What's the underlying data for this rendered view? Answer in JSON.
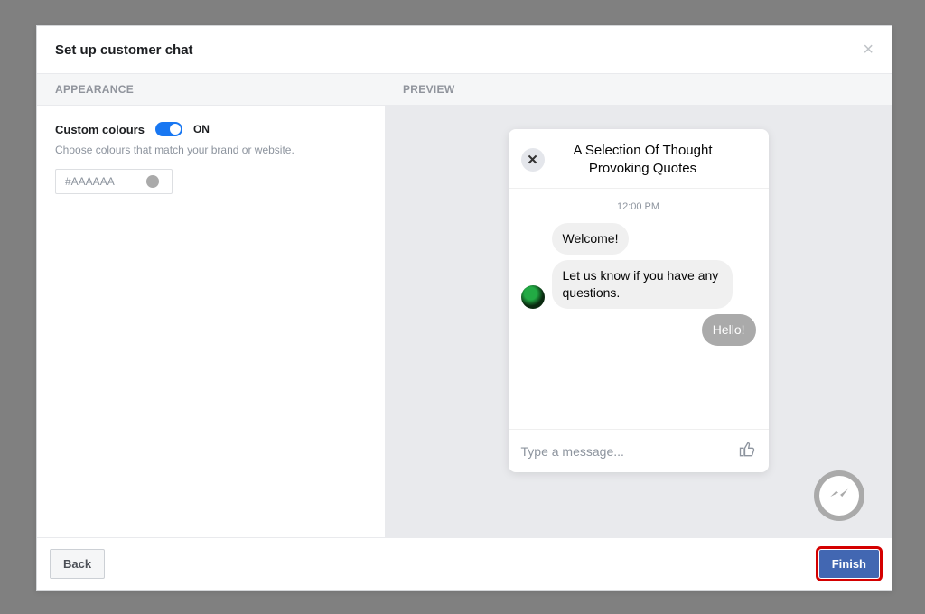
{
  "modal": {
    "title": "Set up customer chat",
    "close_symbol": "×"
  },
  "columns": {
    "left_header": "APPEARANCE",
    "right_header": "PREVIEW"
  },
  "appearance": {
    "custom_colours_label": "Custom colours",
    "toggle_state": "ON",
    "hint": "Choose colours that match your brand or website.",
    "color_value": "#AAAAAA",
    "color_swatch": "#aaaaaa"
  },
  "preview": {
    "chat_title": "A Selection Of Thought Provoking Quotes",
    "close_symbol": "✕",
    "timestamp": "12:00 PM",
    "messages": {
      "m1": "Welcome!",
      "m2": "Let us know if you have any questions.",
      "m3": "Hello!"
    },
    "input_placeholder": "Type a message..."
  },
  "footer": {
    "back_label": "Back",
    "finish_label": "Finish"
  }
}
